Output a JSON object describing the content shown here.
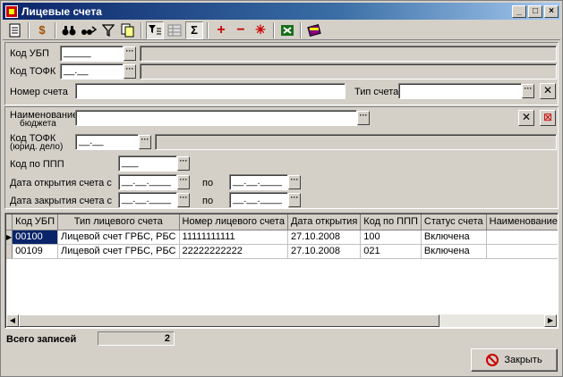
{
  "window": {
    "title": "Лицевые счета"
  },
  "toolbar": {
    "icons": [
      "new-doc-icon",
      "money-icon",
      "binoculars-icon",
      "find-next-icon",
      "filter-icon",
      "copy-doc-icon",
      "filter-toggle-icon",
      "grid-icon",
      "sum-icon",
      "add-icon",
      "remove-icon",
      "star-icon",
      "excel-icon",
      "books-icon"
    ],
    "sum_label": "Σ",
    "add_label": "+",
    "remove_label": "−",
    "star_label": "✳"
  },
  "filters": {
    "kod_ubp": {
      "label": "Код УБП",
      "value": "_____"
    },
    "kod_tofk": {
      "label": "Код ТОФК",
      "value": "__.__"
    },
    "nomer_scheta": {
      "label": "Номер счета",
      "value": ""
    },
    "tip_scheta": {
      "label": "Тип счета",
      "value": ""
    },
    "naim_budzheta": {
      "label1": "Наименование",
      "label2": "бюджета",
      "value": ""
    },
    "kod_tofk_yur": {
      "label1": "Код ТОФК",
      "label2": "(юрид. дело)",
      "value": "__.__"
    },
    "kod_ppp": {
      "label": "Код по ППП",
      "value": "___"
    },
    "date_open": {
      "label": "Дата открытия счета с",
      "from": "__.__.____",
      "to_label": "по",
      "to": "__.__.____"
    },
    "date_close": {
      "label": "Дата закрытия счета с",
      "from": "__.__.____",
      "to_label": "по",
      "to": "__.__.____"
    }
  },
  "grid": {
    "columns": [
      "Код УБП",
      "Тип лицевого счета",
      "Номер лицевого счета",
      "Дата открытия",
      "Код по ППП",
      "Статус счета",
      "Наименование бюджета"
    ],
    "rows": [
      [
        "00100",
        "Лицевой счет ГРБС, РБС",
        "11111111111",
        "27.10.2008",
        "100",
        "Включена",
        ""
      ],
      [
        "00109",
        "Лицевой счет ГРБС, РБС",
        "22222222222",
        "27.10.2008",
        "021",
        "Включена",
        ""
      ]
    ]
  },
  "status": {
    "total_label": "Всего записей",
    "total_value": "2"
  },
  "close_button": {
    "label": "Закрыть"
  }
}
